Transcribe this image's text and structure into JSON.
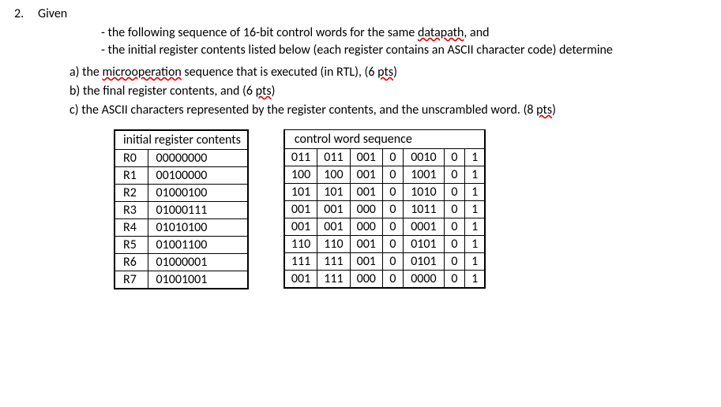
{
  "question": {
    "number": "2.",
    "given": "Given",
    "bullet1_pre": "- the following sequence of 16-bit control words for the same ",
    "bullet1_wig": "datapath",
    "bullet1_post": ", and",
    "bullet2": "- the initial register contents listed below (each register contains an ASCII character code) determine",
    "part_a_pre": "a) the ",
    "part_a_wig": "microoperation",
    "part_a_mid": " sequence that is executed (in RTL), (6 ",
    "part_a_pts": "pts",
    "part_a_end": ")",
    "part_b_pre": "b) the final register contents, and (6 ",
    "part_b_pts": "pts",
    "part_b_end": ")",
    "part_c_pre": "c) the ASCII characters represented by the register contents, and the unscrambled word. (8 ",
    "part_c_pts": "pts",
    "part_c_end": ")"
  },
  "registers": {
    "title": "initial register contents",
    "rows": [
      {
        "name": "R0",
        "val": "00000000"
      },
      {
        "name": "R1",
        "val": "00100000"
      },
      {
        "name": "R2",
        "val": "01000100"
      },
      {
        "name": "R3",
        "val": "01000111"
      },
      {
        "name": "R4",
        "val": "01010100"
      },
      {
        "name": "R5",
        "val": "01001100"
      },
      {
        "name": "R6",
        "val": "01000001"
      },
      {
        "name": "R7",
        "val": "01001001"
      }
    ]
  },
  "control_words": {
    "title": "control word sequence",
    "rows": [
      {
        "c0": "011",
        "c1": "011",
        "c2": "001",
        "c3": "0",
        "c4": "0010",
        "c5": "0",
        "c6": "1"
      },
      {
        "c0": "100",
        "c1": "100",
        "c2": "001",
        "c3": "0",
        "c4": "1001",
        "c5": "0",
        "c6": "1"
      },
      {
        "c0": "101",
        "c1": "101",
        "c2": "001",
        "c3": "0",
        "c4": "1010",
        "c5": "0",
        "c6": "1"
      },
      {
        "c0": "001",
        "c1": "001",
        "c2": "000",
        "c3": "0",
        "c4": "1011",
        "c5": "0",
        "c6": "1"
      },
      {
        "c0": "001",
        "c1": "001",
        "c2": "000",
        "c3": "0",
        "c4": "0001",
        "c5": "0",
        "c6": "1"
      },
      {
        "c0": "110",
        "c1": "110",
        "c2": "001",
        "c3": "0",
        "c4": "0101",
        "c5": "0",
        "c6": "1"
      },
      {
        "c0": "111",
        "c1": "111",
        "c2": "001",
        "c3": "0",
        "c4": "0101",
        "c5": "0",
        "c6": "1"
      },
      {
        "c0": "001",
        "c1": "111",
        "c2": "000",
        "c3": "0",
        "c4": "0000",
        "c5": "0",
        "c6": "1"
      }
    ]
  }
}
